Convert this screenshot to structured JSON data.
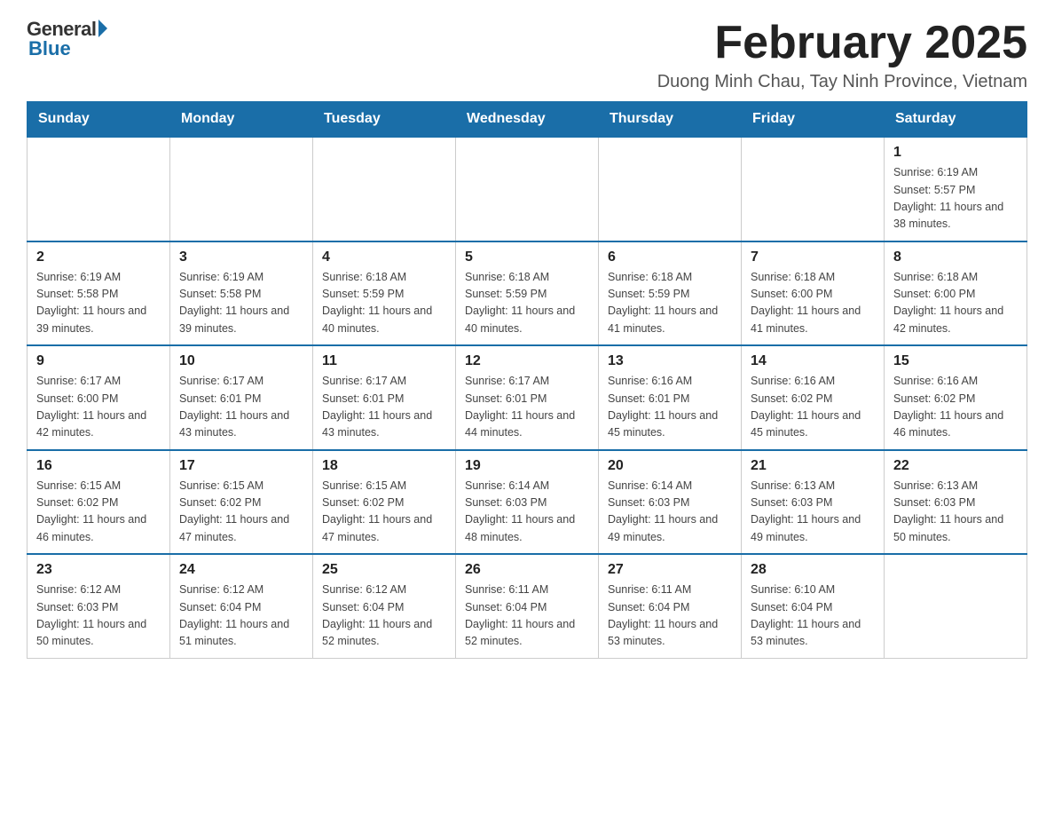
{
  "logo": {
    "general": "General",
    "blue": "Blue"
  },
  "title": "February 2025",
  "location": "Duong Minh Chau, Tay Ninh Province, Vietnam",
  "days_of_week": [
    "Sunday",
    "Monday",
    "Tuesday",
    "Wednesday",
    "Thursday",
    "Friday",
    "Saturday"
  ],
  "weeks": [
    [
      {
        "day": "",
        "info": ""
      },
      {
        "day": "",
        "info": ""
      },
      {
        "day": "",
        "info": ""
      },
      {
        "day": "",
        "info": ""
      },
      {
        "day": "",
        "info": ""
      },
      {
        "day": "",
        "info": ""
      },
      {
        "day": "1",
        "info": "Sunrise: 6:19 AM\nSunset: 5:57 PM\nDaylight: 11 hours and 38 minutes."
      }
    ],
    [
      {
        "day": "2",
        "info": "Sunrise: 6:19 AM\nSunset: 5:58 PM\nDaylight: 11 hours and 39 minutes."
      },
      {
        "day": "3",
        "info": "Sunrise: 6:19 AM\nSunset: 5:58 PM\nDaylight: 11 hours and 39 minutes."
      },
      {
        "day": "4",
        "info": "Sunrise: 6:18 AM\nSunset: 5:59 PM\nDaylight: 11 hours and 40 minutes."
      },
      {
        "day": "5",
        "info": "Sunrise: 6:18 AM\nSunset: 5:59 PM\nDaylight: 11 hours and 40 minutes."
      },
      {
        "day": "6",
        "info": "Sunrise: 6:18 AM\nSunset: 5:59 PM\nDaylight: 11 hours and 41 minutes."
      },
      {
        "day": "7",
        "info": "Sunrise: 6:18 AM\nSunset: 6:00 PM\nDaylight: 11 hours and 41 minutes."
      },
      {
        "day": "8",
        "info": "Sunrise: 6:18 AM\nSunset: 6:00 PM\nDaylight: 11 hours and 42 minutes."
      }
    ],
    [
      {
        "day": "9",
        "info": "Sunrise: 6:17 AM\nSunset: 6:00 PM\nDaylight: 11 hours and 42 minutes."
      },
      {
        "day": "10",
        "info": "Sunrise: 6:17 AM\nSunset: 6:01 PM\nDaylight: 11 hours and 43 minutes."
      },
      {
        "day": "11",
        "info": "Sunrise: 6:17 AM\nSunset: 6:01 PM\nDaylight: 11 hours and 43 minutes."
      },
      {
        "day": "12",
        "info": "Sunrise: 6:17 AM\nSunset: 6:01 PM\nDaylight: 11 hours and 44 minutes."
      },
      {
        "day": "13",
        "info": "Sunrise: 6:16 AM\nSunset: 6:01 PM\nDaylight: 11 hours and 45 minutes."
      },
      {
        "day": "14",
        "info": "Sunrise: 6:16 AM\nSunset: 6:02 PM\nDaylight: 11 hours and 45 minutes."
      },
      {
        "day": "15",
        "info": "Sunrise: 6:16 AM\nSunset: 6:02 PM\nDaylight: 11 hours and 46 minutes."
      }
    ],
    [
      {
        "day": "16",
        "info": "Sunrise: 6:15 AM\nSunset: 6:02 PM\nDaylight: 11 hours and 46 minutes."
      },
      {
        "day": "17",
        "info": "Sunrise: 6:15 AM\nSunset: 6:02 PM\nDaylight: 11 hours and 47 minutes."
      },
      {
        "day": "18",
        "info": "Sunrise: 6:15 AM\nSunset: 6:02 PM\nDaylight: 11 hours and 47 minutes."
      },
      {
        "day": "19",
        "info": "Sunrise: 6:14 AM\nSunset: 6:03 PM\nDaylight: 11 hours and 48 minutes."
      },
      {
        "day": "20",
        "info": "Sunrise: 6:14 AM\nSunset: 6:03 PM\nDaylight: 11 hours and 49 minutes."
      },
      {
        "day": "21",
        "info": "Sunrise: 6:13 AM\nSunset: 6:03 PM\nDaylight: 11 hours and 49 minutes."
      },
      {
        "day": "22",
        "info": "Sunrise: 6:13 AM\nSunset: 6:03 PM\nDaylight: 11 hours and 50 minutes."
      }
    ],
    [
      {
        "day": "23",
        "info": "Sunrise: 6:12 AM\nSunset: 6:03 PM\nDaylight: 11 hours and 50 minutes."
      },
      {
        "day": "24",
        "info": "Sunrise: 6:12 AM\nSunset: 6:04 PM\nDaylight: 11 hours and 51 minutes."
      },
      {
        "day": "25",
        "info": "Sunrise: 6:12 AM\nSunset: 6:04 PM\nDaylight: 11 hours and 52 minutes."
      },
      {
        "day": "26",
        "info": "Sunrise: 6:11 AM\nSunset: 6:04 PM\nDaylight: 11 hours and 52 minutes."
      },
      {
        "day": "27",
        "info": "Sunrise: 6:11 AM\nSunset: 6:04 PM\nDaylight: 11 hours and 53 minutes."
      },
      {
        "day": "28",
        "info": "Sunrise: 6:10 AM\nSunset: 6:04 PM\nDaylight: 11 hours and 53 minutes."
      },
      {
        "day": "",
        "info": ""
      }
    ]
  ]
}
